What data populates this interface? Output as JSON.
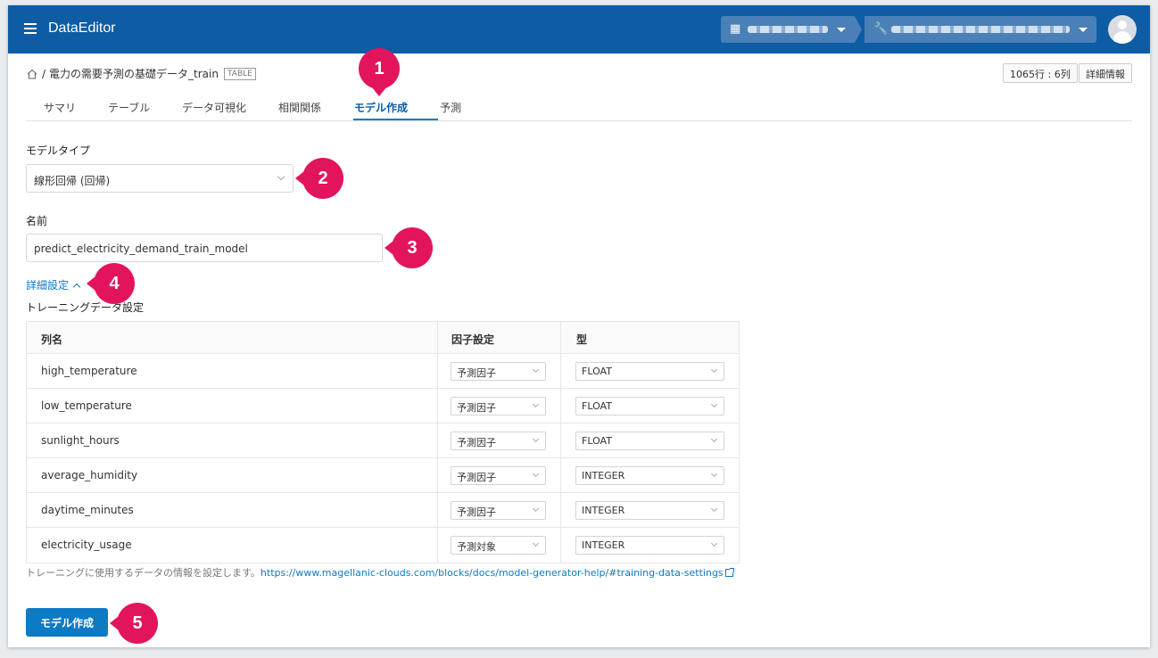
{
  "header": {
    "app_title": "DataEditor",
    "org_icon": "building-icon",
    "project_icon": "wrench-icon"
  },
  "breadcrumb": {
    "separator": "/",
    "dataset_name": "電力の需要予測の基礎データ_train",
    "type_badge": "TABLE"
  },
  "top_right": {
    "rows_cols": "1065行 : 6列",
    "details_button": "詳細情報"
  },
  "tabs": [
    "サマリ",
    "テーブル",
    "データ可視化",
    "相関関係",
    "モデル作成",
    "予測"
  ],
  "active_tab": "モデル作成",
  "form": {
    "model_type_label": "モデルタイプ",
    "model_type_value": "線形回帰 (回帰)",
    "name_label": "名前",
    "name_value": "predict_electricity_demand_train_model",
    "advanced_link": "詳細設定",
    "training_label": "トレーニングデータ設定"
  },
  "table": {
    "headers": [
      "列名",
      "因子設定",
      "型"
    ],
    "rows": [
      {
        "name": "high_temperature",
        "factor": "予測因子",
        "type": "FLOAT"
      },
      {
        "name": "low_temperature",
        "factor": "予測因子",
        "type": "FLOAT"
      },
      {
        "name": "sunlight_hours",
        "factor": "予測因子",
        "type": "FLOAT"
      },
      {
        "name": "average_humidity",
        "factor": "予測因子",
        "type": "INTEGER"
      },
      {
        "name": "daytime_minutes",
        "factor": "予測因子",
        "type": "INTEGER"
      },
      {
        "name": "electricity_usage",
        "factor": "予測対象",
        "type": "INTEGER"
      }
    ]
  },
  "help": {
    "text": "トレーニングに使用するデータの情報を設定します。",
    "link": "https://www.magellanic-clouds.com/blocks/docs/model-generator-help/#training-data-settings"
  },
  "submit_button": "モデル作成",
  "callouts": [
    "1",
    "2",
    "3",
    "4",
    "5"
  ],
  "colors": {
    "header_bg": "#0d5ca4",
    "accent": "#0d7ac4",
    "callout": "#e3145e"
  }
}
